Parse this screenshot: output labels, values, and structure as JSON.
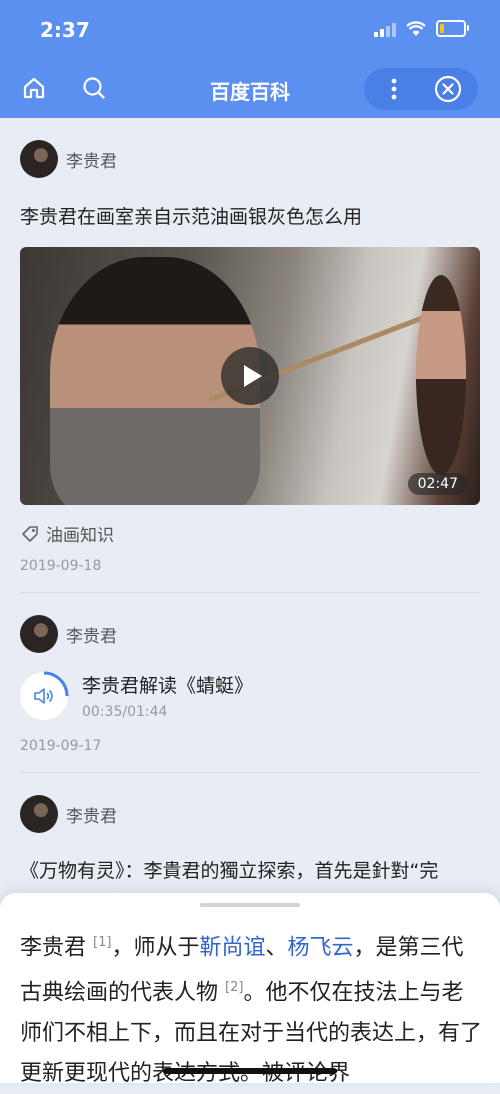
{
  "status_bar": {
    "time": "2:37"
  },
  "navbar": {
    "title": "百度百科"
  },
  "feed": {
    "item1": {
      "author": "李贵君",
      "title": "李贵君在画室亲自示范油画银灰色怎么用",
      "video_duration": "02:47",
      "tag": "油画知识",
      "date": "2019-09-18"
    },
    "item2": {
      "author": "李贵君",
      "audio_title": "李贵君解读《蜻蜓》",
      "audio_time": "00:35/01:44",
      "date": "2019-09-17"
    },
    "item3": {
      "author": "李贵君",
      "excerpt": "《万物有灵》：李貴君的獨立探索，首先是針對“完善”的某種實踐。李貴君說“因為我發現了自"
    }
  },
  "sheet": {
    "name": "李贵君",
    "cite1": "[1]",
    "text_a": "，师从于",
    "link1": "靳尚谊",
    "sep": "、",
    "link2": "杨飞云",
    "text_b": "，是第三代古典绘画的代表人物",
    "cite2": "[2]",
    "text_c": "。他不仅在技法上与老师们不相上下，而且在对于当代的表达上，有了更新更现代的表达方式。被评论界"
  },
  "icons": [
    "home-icon",
    "search-icon",
    "more-icon",
    "close-icon",
    "tag-icon",
    "audio-icon"
  ],
  "colors": {
    "header": "#5b8ff0",
    "link": "#3366cc",
    "background": "#e8edf5"
  }
}
